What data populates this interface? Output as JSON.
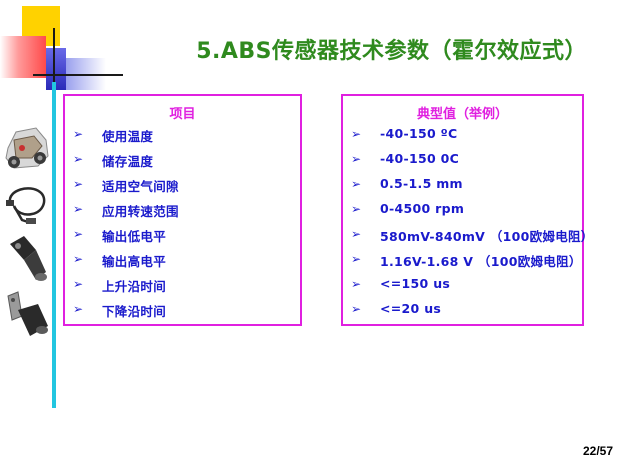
{
  "title": "5.ABS传感器技术参数（霍尔效应式）",
  "left_box": {
    "header": "项目",
    "items": [
      {
        "bullet": "➢",
        "text": "使用温度"
      },
      {
        "bullet": "➢",
        "text": "储存温度"
      },
      {
        "bullet": "➢",
        "text": "适用空气间隙"
      },
      {
        "bullet": "➢",
        "text": "应用转速范围"
      },
      {
        "bullet": "➢",
        "text": "输出低电平"
      },
      {
        "bullet": "➢",
        "text": "输出高电平"
      },
      {
        "bullet": "➢",
        "text": "上升沿时间"
      },
      {
        "bullet": "➢",
        "text": "下降沿时间"
      }
    ]
  },
  "right_box": {
    "header": "典型值（举例）",
    "items": [
      {
        "bullet": "➢",
        "text": "-40-150 ºC"
      },
      {
        "bullet": "➢",
        "text": "-40-150 0C"
      },
      {
        "bullet": "➢",
        "text": "0.5-1.5 mm"
      },
      {
        "bullet": "➢",
        "text": "0-4500 rpm"
      },
      {
        "bullet": "➢",
        "text": "580mV-840mV  （100欧姆电阻）"
      },
      {
        "bullet": "➢",
        "text": "1.16V-1.68 V  （100欧姆电阻）"
      },
      {
        "bullet": "➢",
        "text": "<=150 us"
      },
      {
        "bullet": "➢",
        "text": "<=20 us"
      }
    ]
  },
  "page_number": "22/57",
  "colors": {
    "title": "#2f8a1e",
    "border": "#e020e0",
    "text": "#1a1acc",
    "accent_line": "#22c6e0"
  },
  "icons": [
    "car-chassis-image",
    "sensor-cable-image",
    "speed-sensor-image",
    "bracket-sensor-image"
  ]
}
